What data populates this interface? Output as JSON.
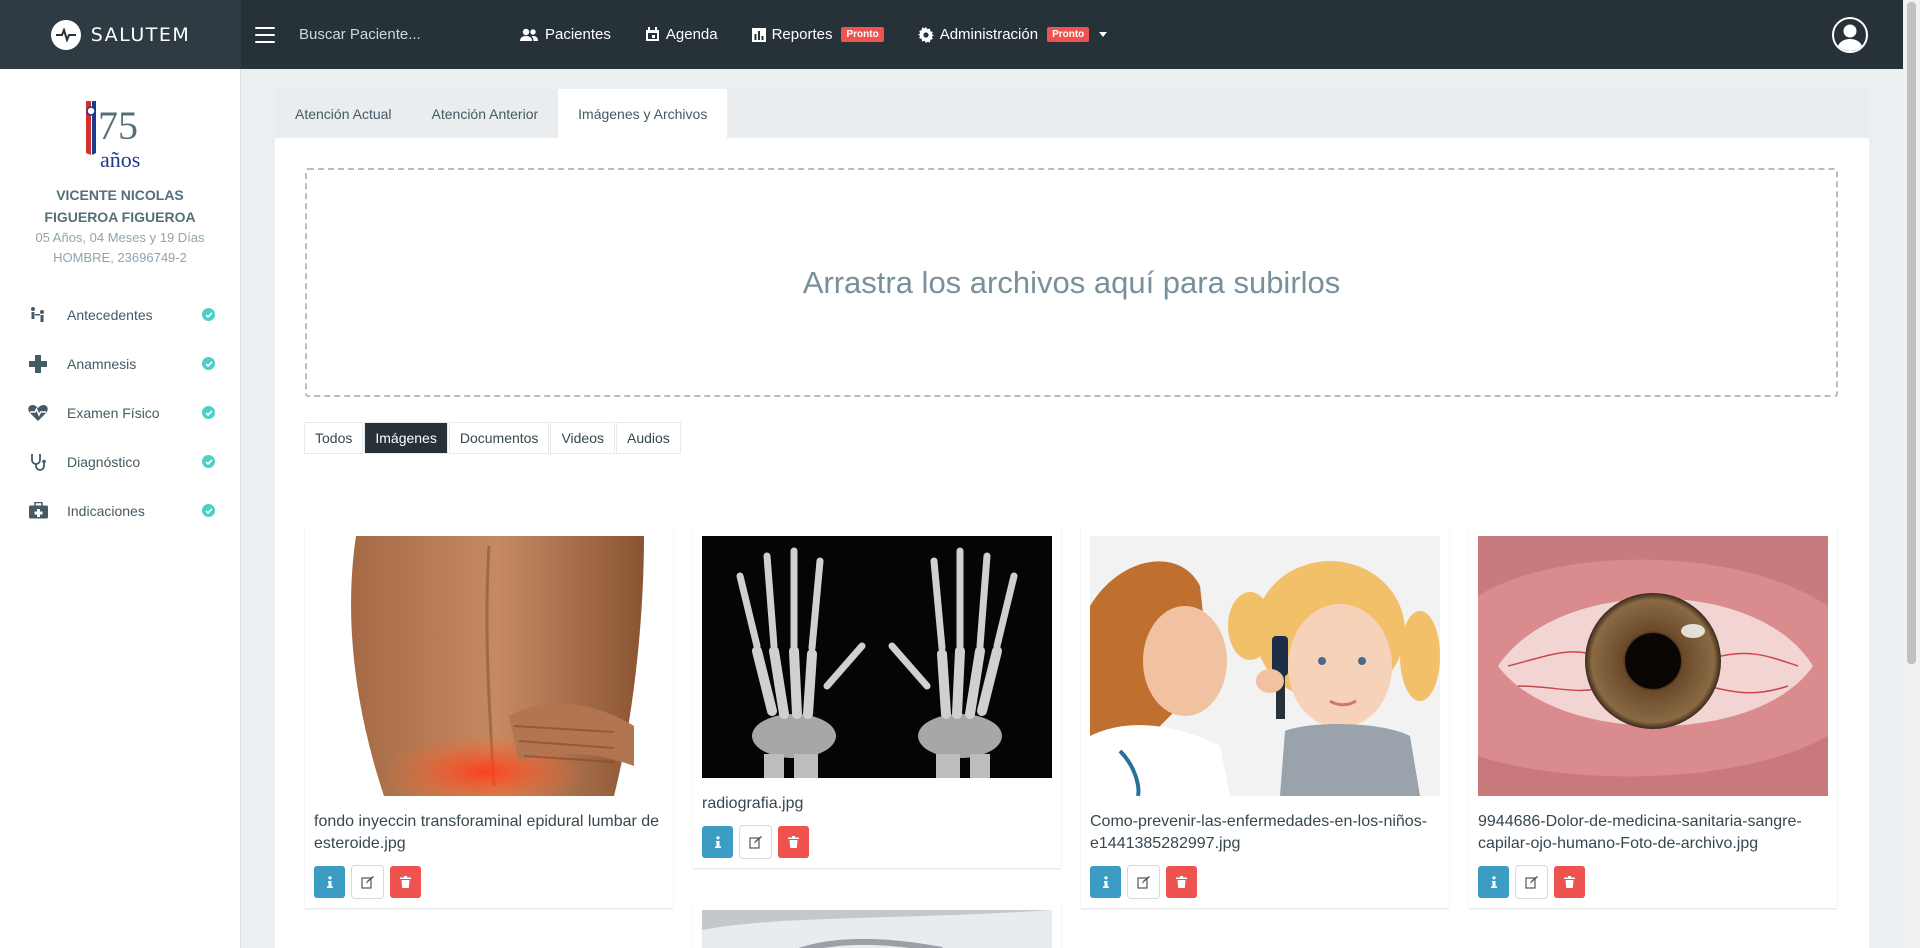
{
  "brand": {
    "name": "SALUTEM"
  },
  "search": {
    "placeholder": "Buscar Paciente..."
  },
  "nav": [
    {
      "label": "Pacientes",
      "icon": "users-icon"
    },
    {
      "label": "Agenda",
      "icon": "calendar-icon"
    },
    {
      "label": "Reportes",
      "icon": "chart-icon",
      "badge": "Pronto"
    },
    {
      "label": "Administración",
      "icon": "gear-icon",
      "badge": "Pronto"
    }
  ],
  "patient": {
    "name_line1": "VICENTE NICOLAS",
    "name_line2": "FIGUEROA FIGUEROA",
    "age": "05 Años, 04 Meses y 19 Días",
    "sex_id": "HOMBRE, 23696749-2",
    "logo_text": "años",
    "logo_number": "75"
  },
  "sidebar": {
    "items": [
      {
        "label": "Antecedentes",
        "icon": "family-icon"
      },
      {
        "label": "Anamnesis",
        "icon": "plus-icon"
      },
      {
        "label": "Examen Físico",
        "icon": "heart-pulse-icon"
      },
      {
        "label": "Diagnóstico",
        "icon": "stethoscope-icon"
      },
      {
        "label": "Indicaciones",
        "icon": "medkit-icon"
      }
    ]
  },
  "tabs": [
    "Atención Actual",
    "Atención Anterior",
    "Imágenes y Archivos"
  ],
  "active_tab": "Imágenes y Archivos",
  "dropzone": {
    "text": "Arrastra los archivos aquí para subirlos"
  },
  "filters": [
    "Todos",
    "Imágenes",
    "Documentos",
    "Videos",
    "Audios"
  ],
  "active_filter": "Imágenes",
  "files": [
    {
      "name": "fondo inyeccin transforaminal epidural lumbar de esteroide.jpg"
    },
    {
      "name": "radiografia.jpg"
    },
    {
      "name": "Como-prevenir-las-enfermedades-en-los-niños-e1441385282997.jpg"
    },
    {
      "name": "9944686-Dolor-de-medicina-sanitaria-sangre-capilar-ojo-humano-Foto-de-archivo.jpg"
    }
  ],
  "colors": {
    "topbar": "#263238",
    "accent_info": "#3d9cc4",
    "danger": "#ef5350",
    "check": "#4dd0c7"
  }
}
